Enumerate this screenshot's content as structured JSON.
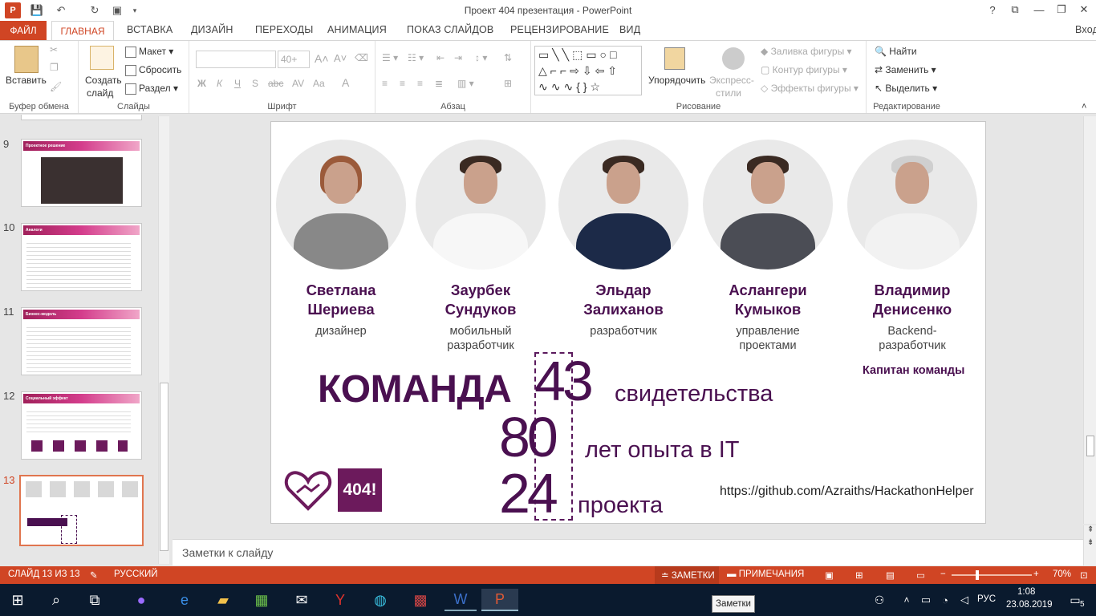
{
  "window": {
    "title": "Проект 404  презентация - PowerPoint",
    "help": "?",
    "minimize": "—",
    "restore": "❐",
    "close": "✕",
    "user": "Вход"
  },
  "tabs": [
    "ФАЙЛ",
    "ГЛАВНАЯ",
    "ВСТАВКА",
    "ДИЗАЙН",
    "ПЕРЕХОДЫ",
    "АНИМАЦИЯ",
    "ПОКАЗ СЛАЙДОВ",
    "РЕЦЕНЗИРОВАНИЕ",
    "ВИД"
  ],
  "ribbon": {
    "clipboard": {
      "paste": "Вставить",
      "label": "Буфер обмена"
    },
    "slides": {
      "create": "Создать",
      "create2": "слайд",
      "layout": "Макет",
      "reset": "Сбросить",
      "section": "Раздел",
      "label": "Слайды"
    },
    "font": {
      "size": "40+",
      "bold": "Ж",
      "italic": "К",
      "underline": "Ч",
      "strike": "S",
      "spacing": "abc",
      "spacing2": "AV",
      "case": "Aa",
      "label": "Шрифт"
    },
    "paragraph": {
      "label": "Абзац"
    },
    "drawing": {
      "arrange": "Упорядочить",
      "styles": "Экспресс-",
      "styles2": "стили",
      "fill": "Заливка фигуры",
      "outline": "Контур фигуры",
      "effects": "Эффекты фигуры",
      "label": "Рисование"
    },
    "editing": {
      "find": "Найти",
      "replace": "Заменить",
      "select": "Выделить",
      "label": "Редактирование"
    }
  },
  "thumbnails": [
    {
      "num": "9",
      "title": "Проектное решение"
    },
    {
      "num": "10",
      "title": "Аналоги"
    },
    {
      "num": "11",
      "title": "Бизнес-модель"
    },
    {
      "num": "12",
      "title": "Социальный эффект"
    },
    {
      "num": "13",
      "title": ""
    }
  ],
  "slide": {
    "people": [
      {
        "first": "Светлана",
        "last": "Шериева",
        "role": "дизайнер",
        "role2": ""
      },
      {
        "first": "Заурбек",
        "last": "Сундуков",
        "role": "мобильный",
        "role2": "разработчик"
      },
      {
        "first": "Эльдар",
        "last": "Залиханов",
        "role": "разработчик",
        "role2": ""
      },
      {
        "first": "Аслангери",
        "last": "Кумыков",
        "role": "управление",
        "role2": "проектами"
      },
      {
        "first": "Владимир",
        "last": "Денисенко",
        "role": "Backend-",
        "role2": "разработчик"
      }
    ],
    "captain": "Капитан команды",
    "team_word": "КОМАНДА",
    "stats": [
      {
        "value": "43",
        "label": "свидетельства"
      },
      {
        "value": "80",
        "label": "лет опыта в IT"
      },
      {
        "value": "24",
        "label": "проекта"
      }
    ],
    "logo_text": "404!",
    "github": "https://github.com/Azraiths/HackathonHelper"
  },
  "notes_placeholder": "Заметки к слайду",
  "status": {
    "slide": "СЛАЙД 13 ИЗ 13",
    "language": "РУССКИЙ",
    "notes": "ЗАМЕТКИ",
    "comments": "ПРИМЕЧАНИЯ",
    "zoom": "70%"
  },
  "taskbar": {
    "lang": "РУС",
    "time": "1:08",
    "date": "23.08.2019",
    "notif": "5",
    "tooltip": "Заметки"
  },
  "colors": {
    "accent": "#d04524",
    "brand_purple": "#4a1050",
    "logo_bg": "#6c1a5c"
  }
}
